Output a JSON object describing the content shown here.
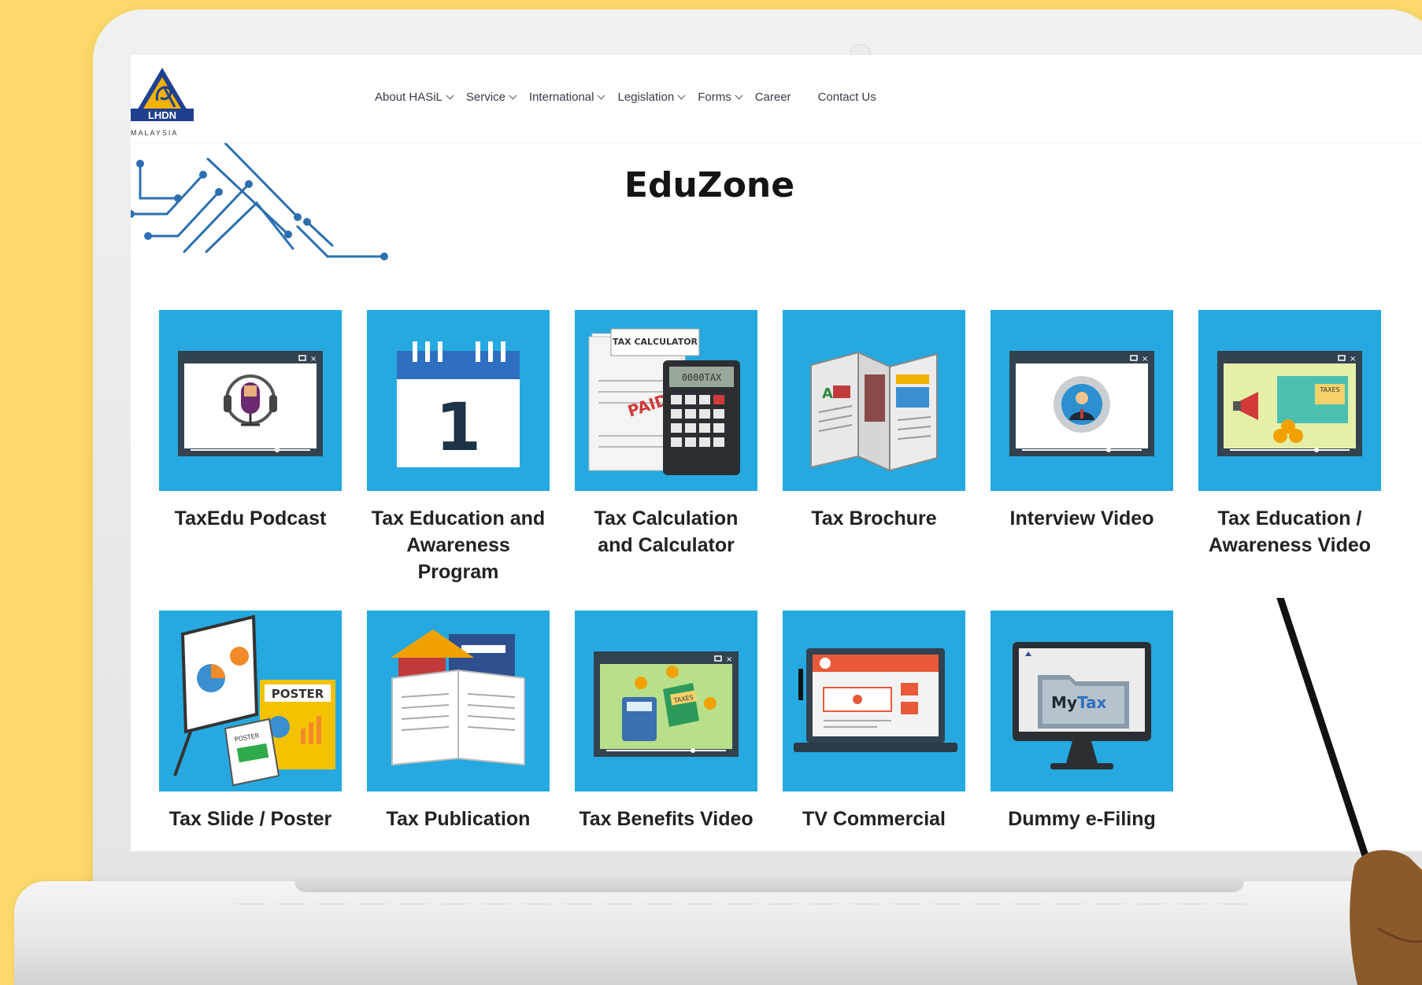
{
  "logo": {
    "text": "LHDN",
    "subtext": "MALAYSIA"
  },
  "nav": {
    "items": [
      {
        "label": "About HASiL",
        "dropdown": true
      },
      {
        "label": "Service",
        "dropdown": true
      },
      {
        "label": "International",
        "dropdown": true
      },
      {
        "label": "Legislation",
        "dropdown": true
      },
      {
        "label": "Forms",
        "dropdown": true
      },
      {
        "label": "Career",
        "dropdown": false
      },
      {
        "label": "Contact Us",
        "dropdown": false
      }
    ]
  },
  "page": {
    "title": "EduZone"
  },
  "tiles": [
    {
      "label": "TaxEdu Podcast",
      "icon": "podcast-video-icon"
    },
    {
      "label": "Tax Education and Awareness Program",
      "icon": "calendar-icon",
      "calendar_day": "1"
    },
    {
      "label": "Tax Calculation and Calculator",
      "icon": "tax-calculator-icon",
      "calc_title": "TAX CALCULATOR",
      "calc_display": "0000TAX",
      "paid_stamp": "PAID"
    },
    {
      "label": "Tax Brochure",
      "icon": "brochure-icon",
      "brochure_letter": "A"
    },
    {
      "label": "Interview Video",
      "icon": "interview-video-icon"
    },
    {
      "label": "Tax Education / Awareness Video",
      "icon": "awareness-video-icon",
      "badge": "TAXES"
    },
    {
      "label": "Tax Slide / Poster",
      "icon": "poster-icon",
      "poster_big": "POSTER",
      "poster_small": "POSTER"
    },
    {
      "label": "Tax Publication",
      "icon": "publication-icon"
    },
    {
      "label": "Tax Benefits Video",
      "icon": "benefits-video-icon",
      "badge": "TAXES"
    },
    {
      "label": "TV Commercial",
      "icon": "tv-commercial-icon"
    },
    {
      "label": "Dummy e-Filing",
      "icon": "efiling-monitor-icon",
      "brand_a": "My",
      "brand_b": "Tax"
    }
  ],
  "colors": {
    "tile_bg": "#25a9e0",
    "background": "#fbd96a",
    "logo_blue": "#1f3f8f",
    "logo_gold": "#f2b200"
  }
}
